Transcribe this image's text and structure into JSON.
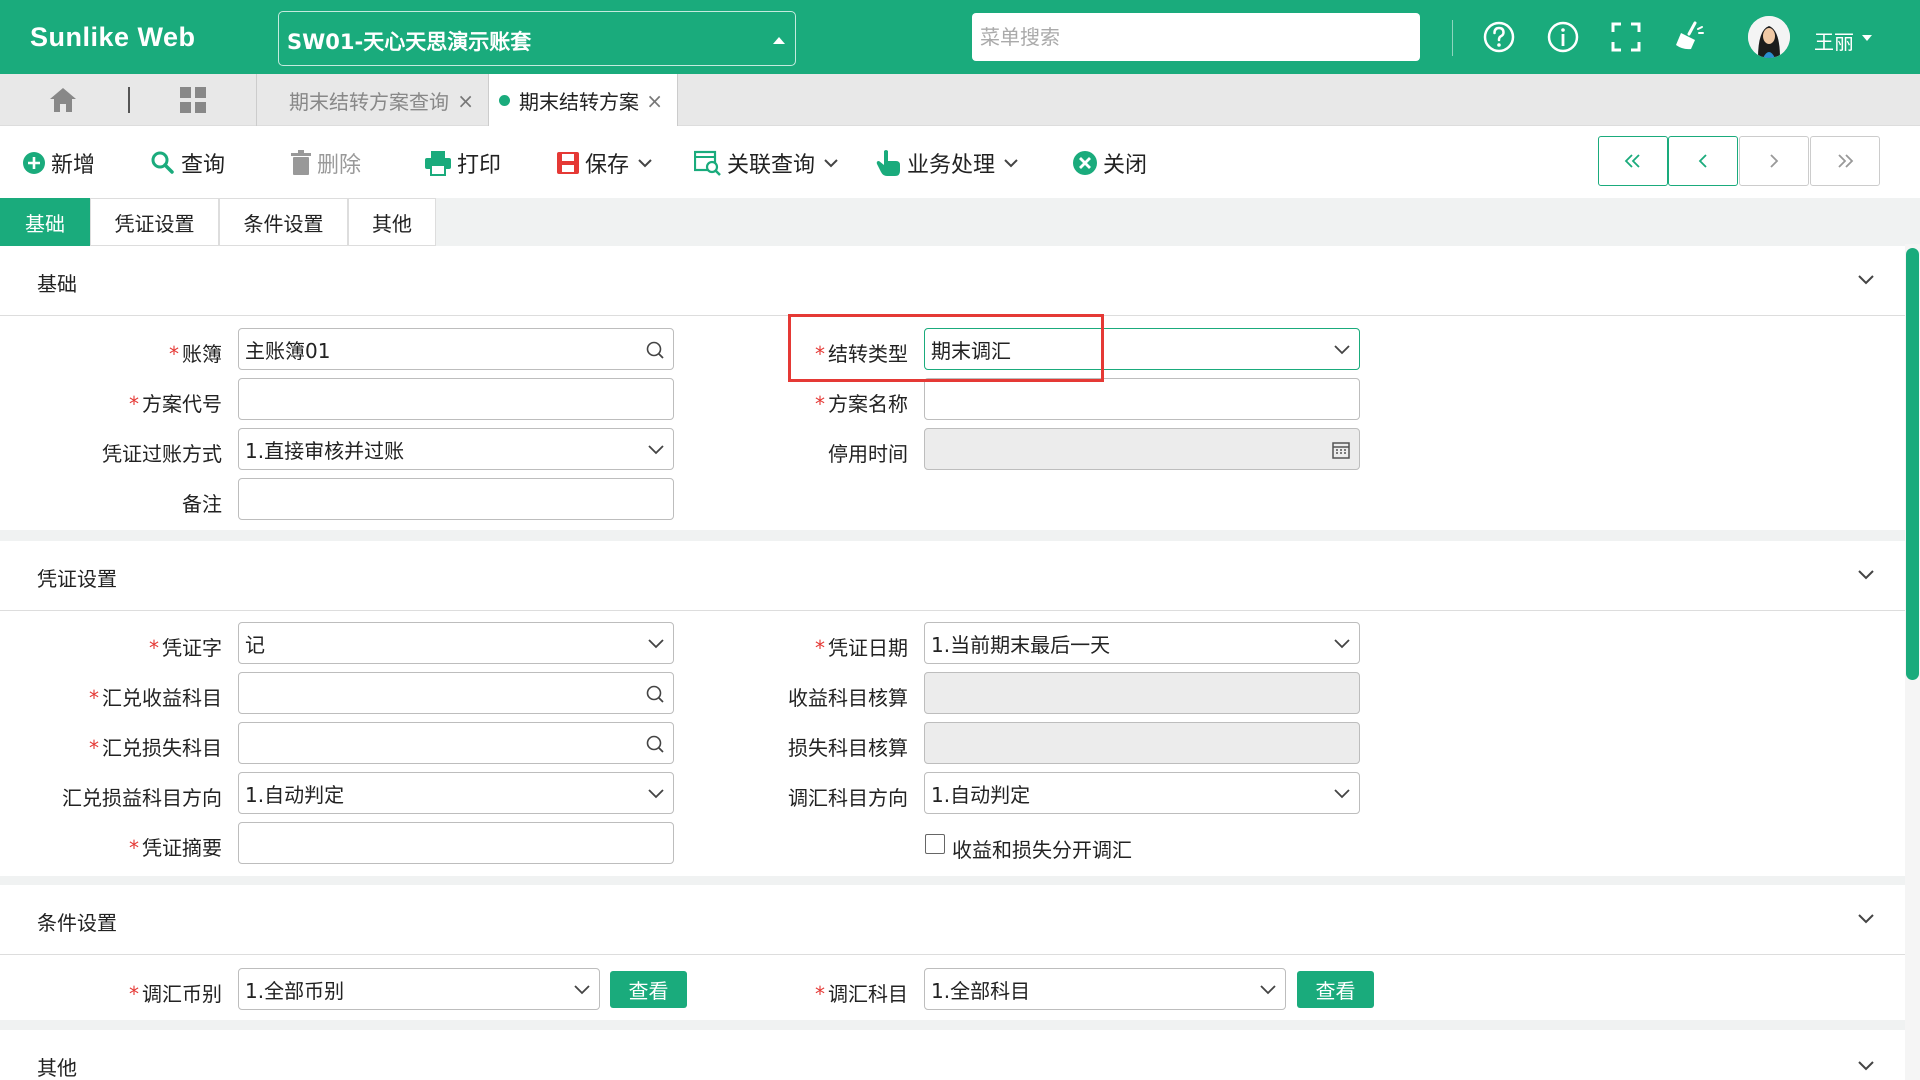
{
  "app": {
    "brand": "Sunlike Web",
    "account_set": "SW01-天心天思演示账套",
    "menu_search_placeholder": "菜单搜索",
    "user_name": "王丽"
  },
  "tabs": [
    {
      "label": "期末结转方案查询",
      "active": false
    },
    {
      "label": "期末结转方案",
      "active": true
    }
  ],
  "toolbar": {
    "add": "新增",
    "query": "查询",
    "delete": "删除",
    "print": "打印",
    "save": "保存",
    "related_query": "关联查询",
    "business": "业务处理",
    "close": "关闭"
  },
  "form_tabs": [
    "基础",
    "凭证设置",
    "条件设置",
    "其他"
  ],
  "sections": {
    "basic": {
      "title": "基础",
      "ledger_label": "账簿",
      "ledger_value": "主账簿01",
      "transfer_type_label": "结转类型",
      "transfer_type_value": "期末调汇",
      "plan_code_label": "方案代号",
      "plan_code_value": "",
      "plan_name_label": "方案名称",
      "plan_name_value": "",
      "posting_label": "凭证过账方式",
      "posting_value": "1.直接审核并过账",
      "disable_time_label": "停用时间",
      "disable_time_value": "",
      "remark_label": "备注",
      "remark_value": ""
    },
    "voucher": {
      "title": "凭证设置",
      "word_label": "凭证字",
      "word_value": "记",
      "date_label": "凭证日期",
      "date_value": "1.当前期末最后一天",
      "gain_label": "汇兑收益科目",
      "gain_value": "",
      "gain_acc_label": "收益科目核算",
      "gain_acc_value": "",
      "loss_label": "汇兑损失科目",
      "loss_value": "",
      "loss_acc_label": "损失科目核算",
      "loss_acc_value": "",
      "dir_label": "汇兑损益科目方向",
      "dir_value": "1.自动判定",
      "adj_dir_label": "调汇科目方向",
      "adj_dir_value": "1.自动判定",
      "summary_label": "凭证摘要",
      "summary_value": "",
      "separate_label": "收益和损失分开调汇",
      "separate_checked": false
    },
    "condition": {
      "title": "条件设置",
      "currency_label": "调汇币别",
      "currency_value": "1.全部币别",
      "view_label": "查看",
      "account_label": "调汇科目",
      "account_value": "1.全部科目"
    },
    "other": {
      "title": "其他"
    }
  },
  "required_mark": "*",
  "colors": {
    "brand": "#1aab7c",
    "required": "#e53935",
    "highlight": "#e53935"
  }
}
